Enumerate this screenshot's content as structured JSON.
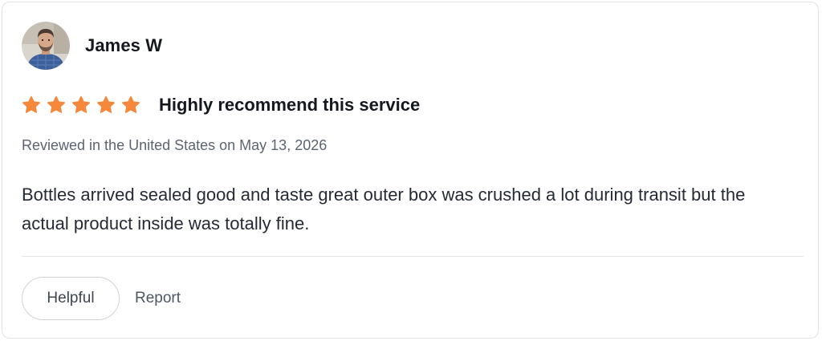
{
  "review": {
    "reviewer": {
      "name": "James W",
      "avatar_icon": "person-avatar-photo"
    },
    "rating": {
      "stars": 5,
      "max": 5,
      "star_color": "#f5883a",
      "star_icon": "star-icon"
    },
    "title": "Highly recommend this service",
    "meta": "Reviewed in the United States on May 13, 2026",
    "body": "Bottles arrived sealed good and taste great outer box was crushed a lot during transit but the actual product inside was totally fine.",
    "actions": {
      "helpful_label": "Helpful",
      "report_label": "Report"
    }
  }
}
